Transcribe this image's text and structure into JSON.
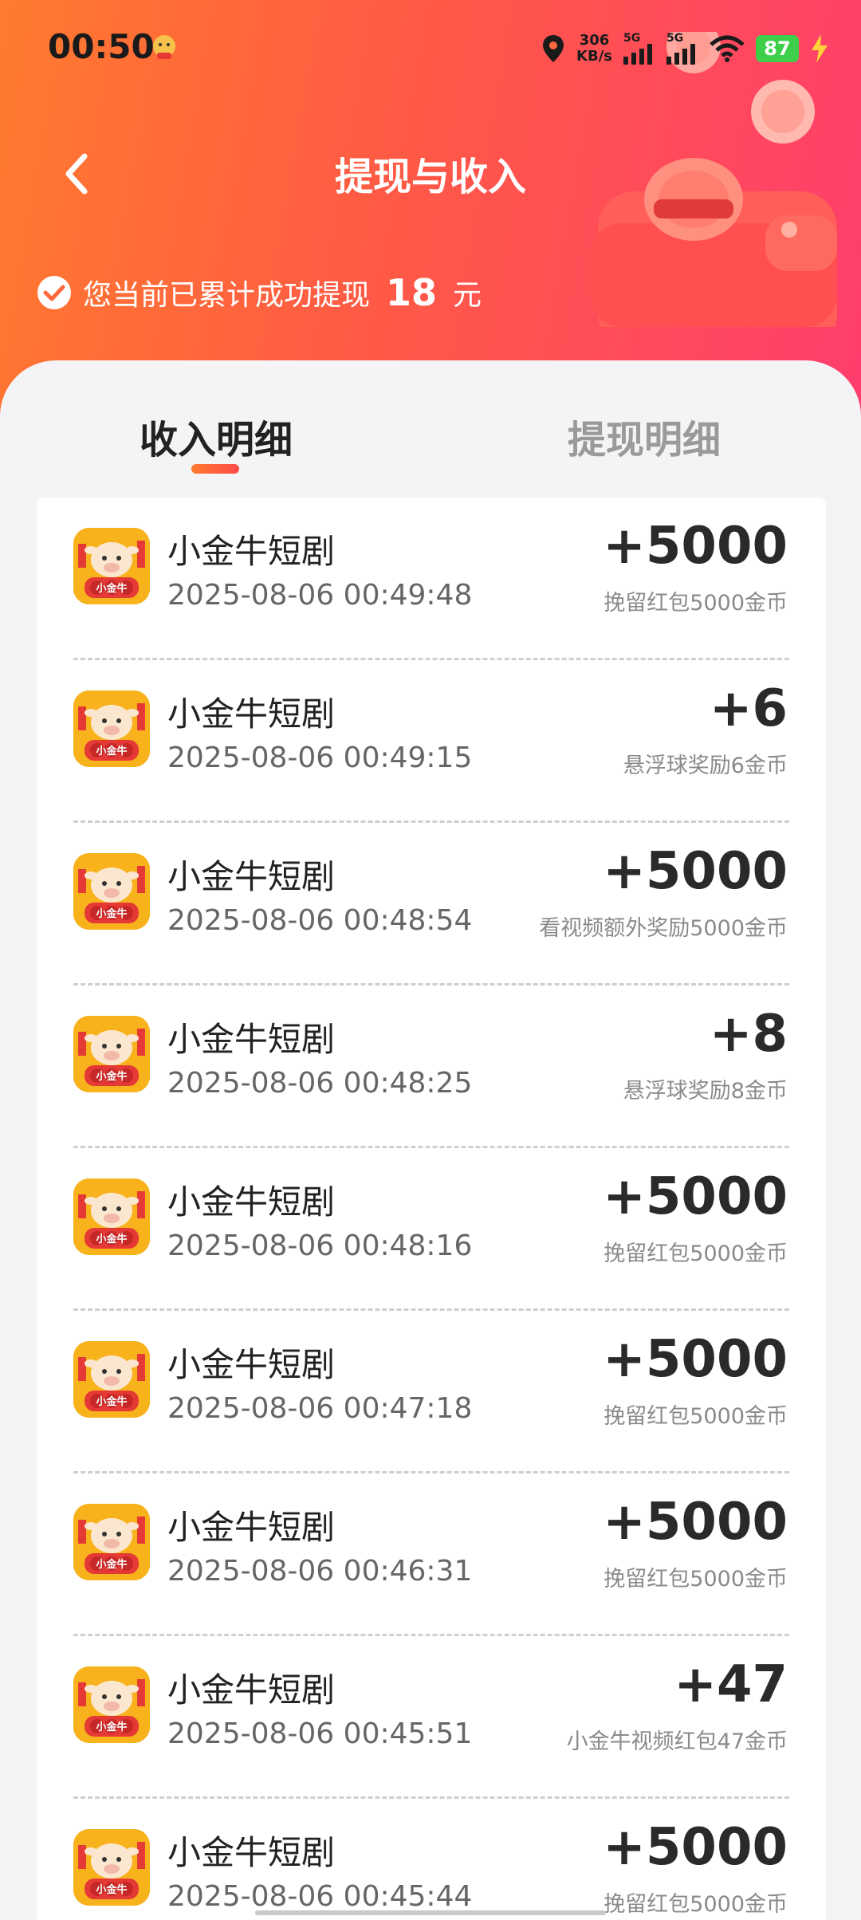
{
  "status": {
    "time": "00:50",
    "net_speed_value": "306",
    "net_speed_unit": "KB/s",
    "sig1": "5G",
    "sig2": "5G",
    "battery": "87"
  },
  "nav": {
    "title": "提现与收入"
  },
  "summary": {
    "text": "您当前已累计成功提现",
    "amount": "18",
    "unit": "元"
  },
  "tabs": [
    {
      "label": "收入明细",
      "active": true
    },
    {
      "label": "提现明细",
      "active": false
    }
  ],
  "icon_label": "小金牛",
  "records": [
    {
      "name": "小金牛短剧",
      "time": "2025-08-06 00:49:48",
      "amount": "+5000",
      "desc": "挽留红包5000金币"
    },
    {
      "name": "小金牛短剧",
      "time": "2025-08-06 00:49:15",
      "amount": "+6",
      "desc": "悬浮球奖励6金币"
    },
    {
      "name": "小金牛短剧",
      "time": "2025-08-06 00:48:54",
      "amount": "+5000",
      "desc": "看视频额外奖励5000金币"
    },
    {
      "name": "小金牛短剧",
      "time": "2025-08-06 00:48:25",
      "amount": "+8",
      "desc": "悬浮球奖励8金币"
    },
    {
      "name": "小金牛短剧",
      "time": "2025-08-06 00:48:16",
      "amount": "+5000",
      "desc": "挽留红包5000金币"
    },
    {
      "name": "小金牛短剧",
      "time": "2025-08-06 00:47:18",
      "amount": "+5000",
      "desc": "挽留红包5000金币"
    },
    {
      "name": "小金牛短剧",
      "time": "2025-08-06 00:46:31",
      "amount": "+5000",
      "desc": "挽留红包5000金币"
    },
    {
      "name": "小金牛短剧",
      "time": "2025-08-06 00:45:51",
      "amount": "+47",
      "desc": "小金牛视频红包47金币"
    },
    {
      "name": "小金牛短剧",
      "time": "2025-08-06 00:45:44",
      "amount": "+5000",
      "desc": "挽留红包5000金币"
    }
  ]
}
